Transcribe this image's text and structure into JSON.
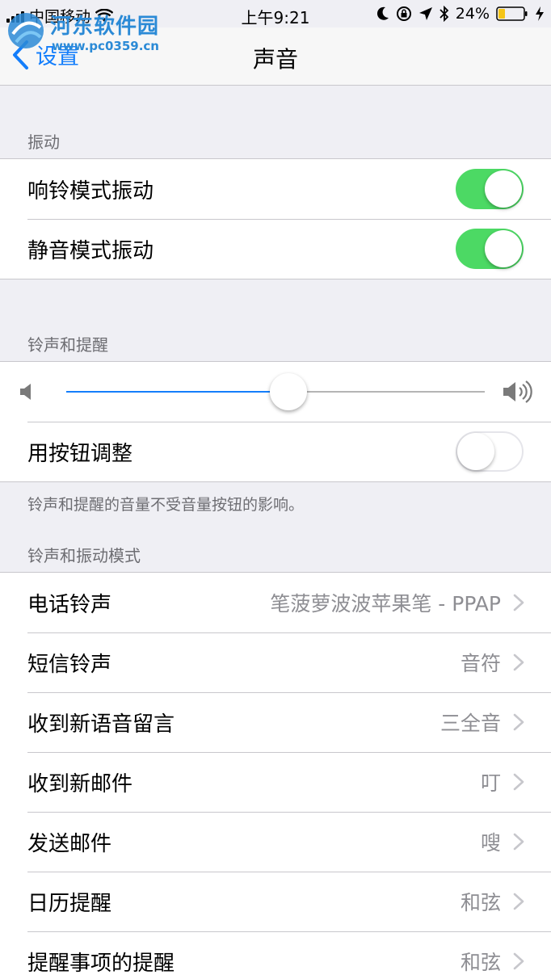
{
  "status_bar": {
    "carrier": "中国移动",
    "time": "上午9:21",
    "battery": "24%"
  },
  "watermark": {
    "title": "河东软件园",
    "url": "www.pc0359.cn"
  },
  "nav": {
    "back_label": "设置",
    "title": "声音"
  },
  "vibration": {
    "header": "振动",
    "items": [
      {
        "label": "响铃模式振动",
        "enabled": true
      },
      {
        "label": "静音模式振动",
        "enabled": true
      }
    ]
  },
  "ringer": {
    "header": "铃声和提醒",
    "volume": 0.53,
    "adjust_with_buttons": {
      "label": "用按钮调整",
      "enabled": false
    },
    "footer": "铃声和提醒的音量不受音量按钮的影响。"
  },
  "patterns": {
    "header": "铃声和振动模式",
    "items": [
      {
        "label": "电话铃声",
        "value": "笔菠萝波波苹果笔 - PPAP"
      },
      {
        "label": "短信铃声",
        "value": "音符"
      },
      {
        "label": "收到新语音留言",
        "value": "三全音"
      },
      {
        "label": "收到新邮件",
        "value": "叮"
      },
      {
        "label": "发送邮件",
        "value": "嗖"
      },
      {
        "label": "日历提醒",
        "value": "和弦"
      },
      {
        "label": "提醒事项的提醒",
        "value": "和弦"
      }
    ]
  },
  "colors": {
    "accent": "#147efb",
    "toggle_on": "#4cd964"
  }
}
